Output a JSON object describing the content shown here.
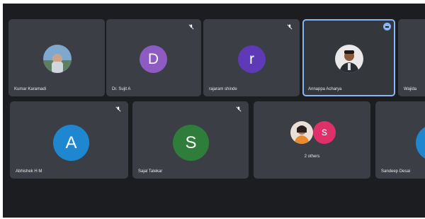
{
  "participants": [
    {
      "name": "Kumar Karamadi",
      "avatar_type": "photo"
    },
    {
      "name": "Dr. Sujit A",
      "initial": "D",
      "avatar_color": "#8e5bc3",
      "muted": true
    },
    {
      "name": "rajaram shinde",
      "initial": "r",
      "avatar_color": "#5f3ab7",
      "muted": true
    },
    {
      "name": "Annappa Acharya",
      "avatar_type": "photo",
      "speaking": true
    },
    {
      "name": "Wajida",
      "avatar_type": "photo"
    },
    {
      "name": "Abhishek H M",
      "initial": "A",
      "avatar_color": "#1f87d0",
      "muted": true
    },
    {
      "name": "Sajal Talekar",
      "initial": "S",
      "avatar_color": "#2f7d3a",
      "muted": true
    },
    {
      "label": "2 others",
      "initial": "s",
      "avatar_color": "#e0306a"
    },
    {
      "name": "Sandeep Desai",
      "avatar_color": "#1f87d0"
    }
  ],
  "colors": {
    "background": "#1c1d20",
    "tile": "#3b3e44",
    "active_border": "#8ab4f8"
  }
}
